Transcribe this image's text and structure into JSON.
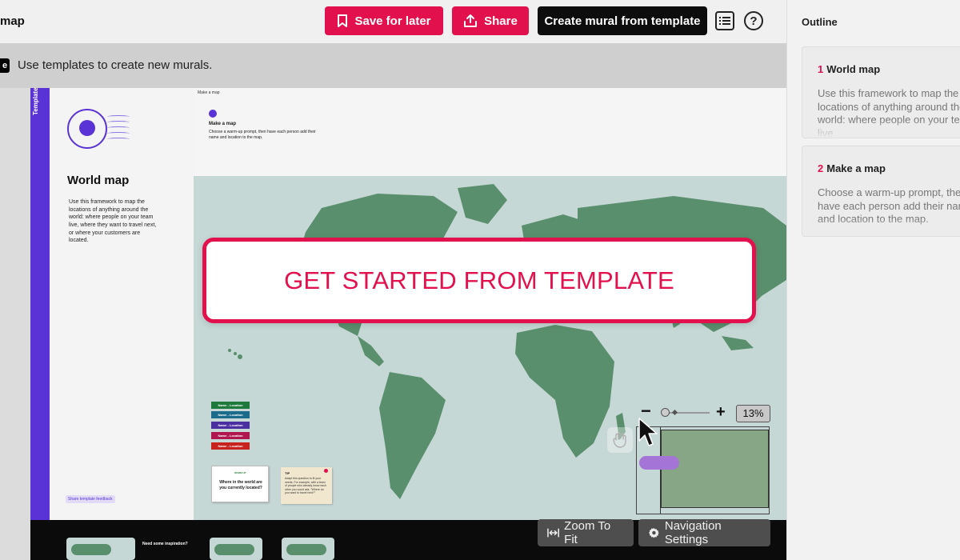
{
  "app": {
    "title": "map"
  },
  "toolbar": {
    "save_label": "Save for later",
    "share_label": "Share",
    "create_label": "Create mural from template"
  },
  "info": {
    "badge": "e",
    "text": "Use templates to create new murals."
  },
  "template": {
    "strip_label": "Template",
    "title": "World map",
    "description": "Use this framework to map the locations of anything around the world: where people on your team live, where they want to travel next, or where your customers are located.",
    "feedback_label": "Share template feedback"
  },
  "map": {
    "header_tiny": "Make a map",
    "header_title": "Make a map",
    "header_desc": "Choose a warm-up prompt, then have each person add their name and location to the map.",
    "location_tags": [
      {
        "label": "Name - Location",
        "color": "#1d7a3c"
      },
      {
        "label": "Name - Location",
        "color": "#1b6b8a"
      },
      {
        "label": "Name - Location",
        "color": "#4a2fa0"
      },
      {
        "label": "Name - Location",
        "color": "#b0154e"
      },
      {
        "label": "Name - Location",
        "color": "#c8221e"
      }
    ],
    "warmup_tag": "WARM UP",
    "warmup_question": "Where in the world are you currently located?",
    "tip_title": "TIP",
    "tip_text": "Adapt this question to fit your needs. For example, with a team of people who already know each other you could ask, \"Where do you want to travel next?\""
  },
  "bottom_strip": {
    "inspiration": "Need some inspiration?"
  },
  "cta": {
    "label": "GET STARTED FROM TEMPLATE"
  },
  "zoom": {
    "level": "13%",
    "minus": "−",
    "plus": "+"
  },
  "nav": {
    "zoom_fit_label": "Zoom To Fit",
    "nav_settings_label": "Navigation Settings"
  },
  "outline": {
    "title": "Outline",
    "items": [
      {
        "number": "1",
        "title": "World map",
        "description": "Use this framework to map the locations of anything around the world: where people on your team live"
      },
      {
        "number": "2",
        "title": "Make a map",
        "description": "Choose a warm-up prompt, then have each person add their name and location to the map."
      }
    ]
  },
  "colors": {
    "accent": "#e2104c",
    "brand_purple": "#5a33d6",
    "dark": "#0d0d0d",
    "map_water": "#c6d8d6",
    "map_land": "#5a8f6d"
  },
  "icons": [
    "bookmark-icon",
    "share-icon",
    "outline-list-icon",
    "help-icon",
    "globe-icon",
    "hand-icon",
    "cursor-icon",
    "zoom-fit-icon",
    "gear-icon"
  ]
}
